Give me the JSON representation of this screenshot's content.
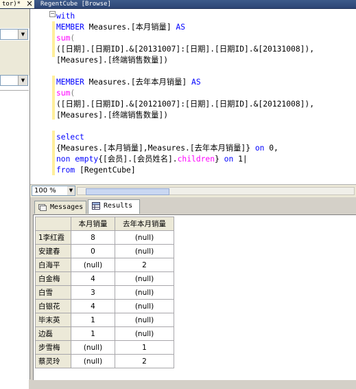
{
  "tabs": {
    "left_tab_title": "tor)*",
    "close_glyph": "×",
    "right_tab_title": "RegentCube [Browse]"
  },
  "editor": {
    "lines": [
      [
        {
          "t": "with",
          "c": "kw"
        }
      ],
      [
        {
          "t": "MEMBER",
          "c": "kw"
        },
        {
          "t": " Measures.[本月销量] ",
          "c": ""
        },
        {
          "t": "AS",
          "c": "kw"
        }
      ],
      [
        {
          "t": "sum",
          "c": "fn"
        },
        {
          "t": "(",
          "c": "grey"
        }
      ],
      [
        {
          "t": "([日期].[日期ID].&[20131007]:[日期].[日期ID].&[20131008]),",
          "c": ""
        }
      ],
      [
        {
          "t": "[Measures].[终端销售数量])",
          "c": ""
        }
      ],
      [
        {
          "t": "",
          "c": ""
        }
      ],
      [
        {
          "t": "MEMBER",
          "c": "kw"
        },
        {
          "t": " Measures.[去年本月销量] ",
          "c": ""
        },
        {
          "t": "AS",
          "c": "kw"
        }
      ],
      [
        {
          "t": "sum",
          "c": "fn"
        },
        {
          "t": "(",
          "c": "grey"
        }
      ],
      [
        {
          "t": "([日期].[日期ID].&[20121007]:[日期].[日期ID].&[20121008]),",
          "c": ""
        }
      ],
      [
        {
          "t": "[Measures].[终端销售数量])",
          "c": ""
        }
      ],
      [
        {
          "t": "",
          "c": ""
        }
      ],
      [
        {
          "t": "select",
          "c": "kw"
        }
      ],
      [
        {
          "t": "{Measures.[本月销量],Measures.[去年本月销量]} ",
          "c": ""
        },
        {
          "t": "on",
          "c": "kw"
        },
        {
          "t": " 0,",
          "c": ""
        }
      ],
      [
        {
          "t": "non empty",
          "c": "kw"
        },
        {
          "t": "{[会员].[会员姓名].",
          "c": ""
        },
        {
          "t": "children",
          "c": "fn"
        },
        {
          "t": "} ",
          "c": ""
        },
        {
          "t": "on",
          "c": "kw"
        },
        {
          "t": " 1|",
          "c": ""
        }
      ],
      [
        {
          "t": "from",
          "c": "kw"
        },
        {
          "t": " [RegentCube]",
          "c": ""
        }
      ]
    ],
    "collapse_glyph": "−"
  },
  "zoom": {
    "value": "100 %"
  },
  "results": {
    "tabs": [
      {
        "label": "Messages",
        "icon": "messages-icon",
        "selected": false
      },
      {
        "label": "Results",
        "icon": "grid-icon",
        "selected": true
      }
    ],
    "columns": [
      "本月销量",
      "去年本月销量"
    ],
    "rows": [
      {
        "name": "1李红霞",
        "v1": "8",
        "v2": "(null)"
      },
      {
        "name": "安建春",
        "v1": "0",
        "v2": "(null)"
      },
      {
        "name": "白海平",
        "v1": "(null)",
        "v2": "2"
      },
      {
        "name": "白金梅",
        "v1": "4",
        "v2": "(null)"
      },
      {
        "name": "白雪",
        "v1": "3",
        "v2": "(null)"
      },
      {
        "name": "白银花",
        "v1": "4",
        "v2": "(null)"
      },
      {
        "name": "毕末英",
        "v1": "1",
        "v2": "(null)"
      },
      {
        "name": "边磊",
        "v1": "1",
        "v2": "(null)"
      },
      {
        "name": "步雪梅",
        "v1": "(null)",
        "v2": "1"
      },
      {
        "name": "蔡灵玲",
        "v1": "(null)",
        "v2": "2"
      }
    ]
  },
  "colors": {
    "keyword": "#0000ff",
    "function": "#ff00ff",
    "change_bar": "#ffef9b",
    "tab_strip": "#3d5a8a"
  }
}
